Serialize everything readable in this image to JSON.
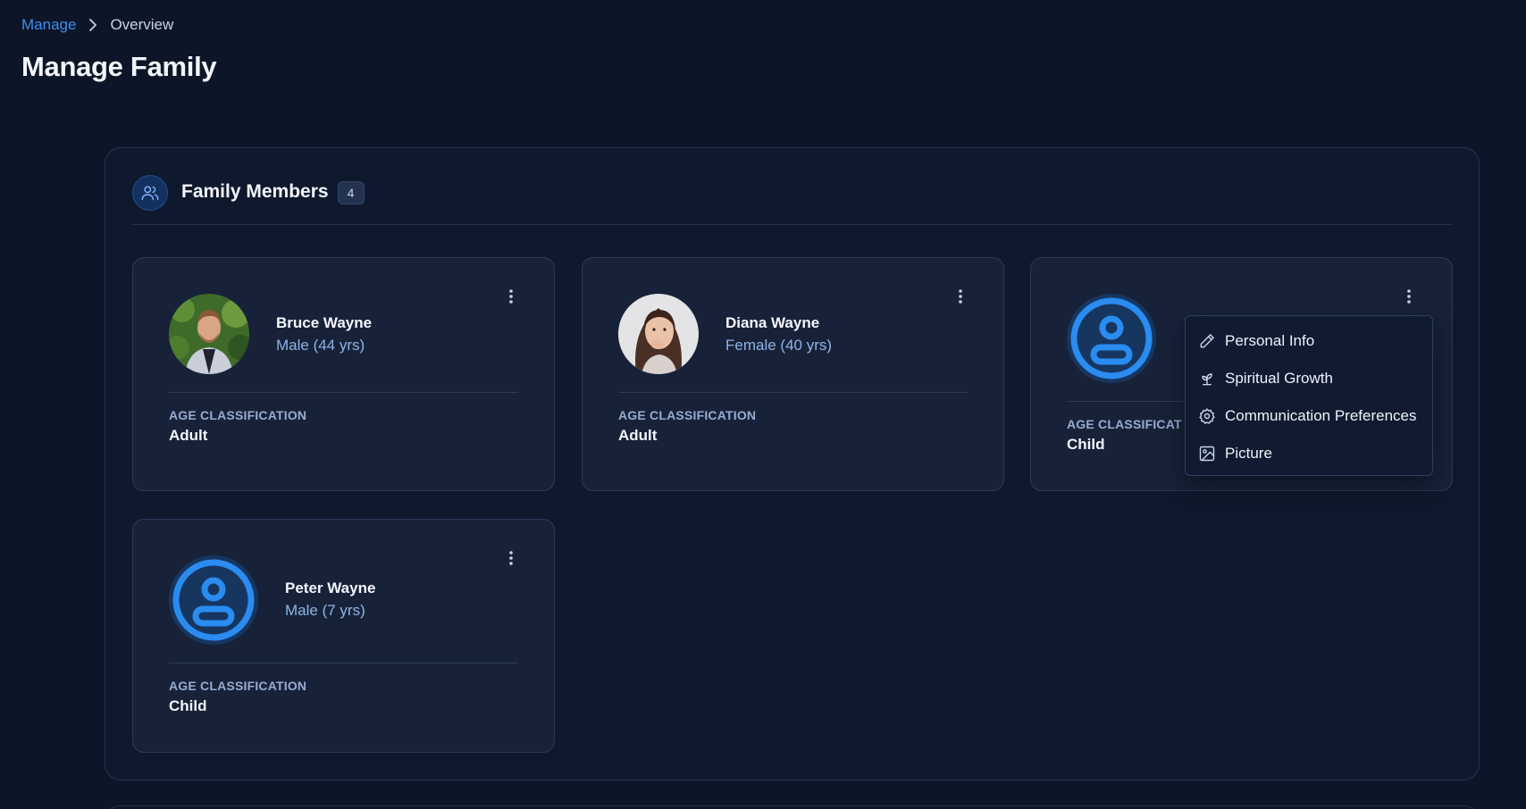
{
  "breadcrumb": {
    "parent": "Manage",
    "current": "Overview"
  },
  "page": {
    "title": "Manage Family"
  },
  "panel": {
    "title": "Family Members",
    "count": "4"
  },
  "members": [
    {
      "name": "Bruce Wayne",
      "sub": "Male (44 yrs)",
      "age_label": "AGE CLASSIFICATION",
      "age_value": "Adult",
      "avatar": "photo"
    },
    {
      "name": "Diana Wayne",
      "sub": "Female (40 yrs)",
      "age_label": "AGE CLASSIFICATION",
      "age_value": "Adult",
      "avatar": "photo"
    },
    {
      "name": "",
      "sub": "",
      "age_label": "AGE CLASSIFICAT",
      "age_value": "Child",
      "avatar": "default-user-icon"
    },
    {
      "name": "Peter Wayne",
      "sub": "Male (7 yrs)",
      "age_label": "AGE CLASSIFICATION",
      "age_value": "Child",
      "avatar": "default-user-icon"
    }
  ],
  "menu": {
    "items": [
      {
        "label": "Personal Info",
        "icon": "pencil-icon"
      },
      {
        "label": "Spiritual Growth",
        "icon": "sprout-icon"
      },
      {
        "label": "Communication Preferences",
        "icon": "gear-icon"
      },
      {
        "label": "Picture",
        "icon": "image-icon"
      }
    ]
  },
  "colors": {
    "accent": "#3d8ef0",
    "background": "#0d1628",
    "card": "#172239",
    "border": "#2b3a5b"
  }
}
